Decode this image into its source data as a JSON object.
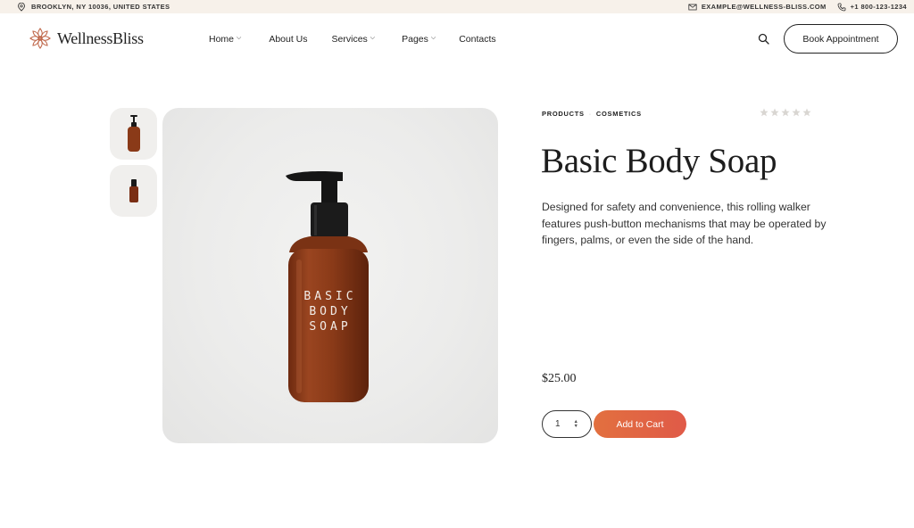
{
  "topbar": {
    "location": "BROOKLYN, NY 10036, UNITED STATES",
    "email": "EXAMPLE@WELLNESS-BLISS.COM",
    "phone": "+1 800-123-1234",
    "icons": [
      "location-pin-icon",
      "mail-icon",
      "phone-icon"
    ]
  },
  "header": {
    "logo_text": "WellnessBliss",
    "nav": [
      {
        "label": "Home",
        "dropdown": true
      },
      {
        "label": "About Us",
        "dropdown": false
      },
      {
        "label": "Services",
        "dropdown": true
      },
      {
        "label": "Pages",
        "dropdown": true
      },
      {
        "label": "Contacts",
        "dropdown": false
      }
    ],
    "book_label": "Book Appointment"
  },
  "product": {
    "breadcrumb": [
      "PRODUCTS",
      "COSMETICS"
    ],
    "rating": 0,
    "rating_max": 5,
    "title": "Basic Body Soap",
    "description": "Designed for safety and convenience, this rolling walker features push-button mechanisms that may be operated by fingers, palms, or even the side of the hand.",
    "price": "$25.00",
    "quantity": "1",
    "add_to_cart": "Add to Cart",
    "image_label": [
      "BASIC",
      "BODY",
      "SOAP"
    ]
  },
  "colors": {
    "topbar_bg": "#f7f1ea",
    "accent_start": "#e2703f",
    "accent_end": "#e05a48",
    "bottle": "#8a3a18",
    "logo": "#c0694c"
  }
}
